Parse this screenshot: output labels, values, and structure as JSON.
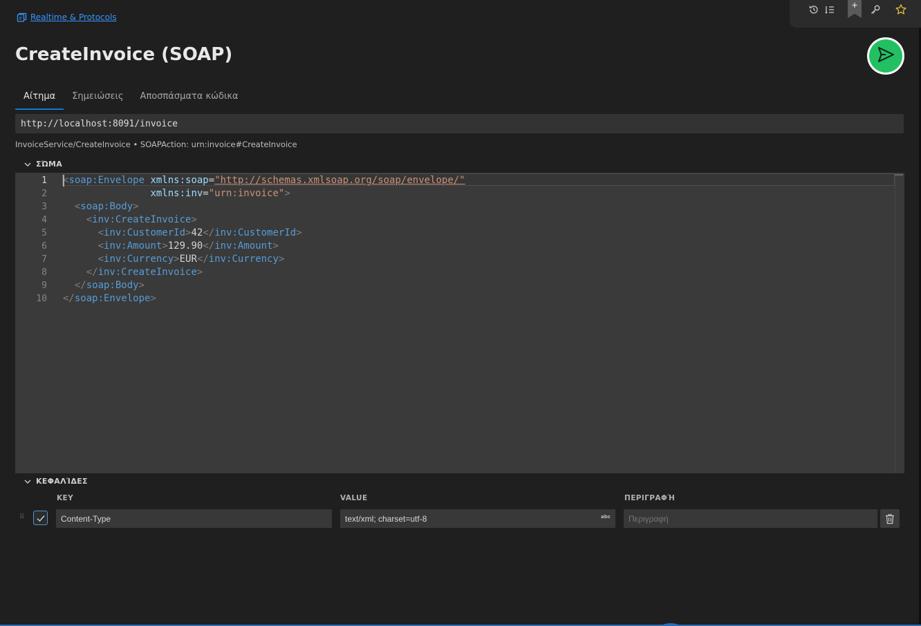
{
  "breadcrumb": {
    "label": "Realtime & Protocols"
  },
  "page": {
    "title": "CreateInvoice (SOAP)"
  },
  "tabs": [
    {
      "label": "Αίτημα",
      "active": true
    },
    {
      "label": "Σημειώσεις",
      "active": false
    },
    {
      "label": "Αποσπάσματα κώδικα",
      "active": false
    }
  ],
  "request": {
    "url": "http://localhost:8091/invoice",
    "operation_info": "InvoiceService/CreateInvoice • SOAPAction: urn:invoice#CreateInvoice"
  },
  "body_section": {
    "title": "ΣΏΜΑ",
    "line_numbers": [
      "1",
      "2",
      "3",
      "4",
      "5",
      "6",
      "7",
      "8",
      "9",
      "10"
    ],
    "current_line": 1,
    "code": {
      "l1_tag": "soap:Envelope",
      "l1_attr": "xmlns:soap",
      "l1_val": "\"http://schemas.xmlsoap.org/soap/envelope/\"",
      "l2_attr": "xmlns:inv",
      "l2_val": "\"urn:invoice\"",
      "l3_tag": "soap:Body",
      "l4_tag": "inv:CreateInvoice",
      "l5_tag": "inv:CustomerId",
      "l5_text": "42",
      "l6_tag": "inv:Amount",
      "l6_text": "129.90",
      "l7_tag": "inv:Currency",
      "l7_text": "EUR",
      "l8_tag": "inv:CreateInvoice",
      "l9_tag": "soap:Body",
      "l10_tag": "soap:Envelope"
    }
  },
  "headers_section": {
    "title": "ΚΕΦΑΛΊΔΕΣ",
    "columns": {
      "key": "KEY",
      "value": "VALUE",
      "description": "ΠΕΡΙΓΡΑΦΉ"
    },
    "rows": [
      {
        "enabled": true,
        "key": "Content-Type",
        "value": "text/xml; charset=utf-8",
        "value_type_badge": "abc",
        "description_placeholder": "Περιγραφή"
      }
    ]
  },
  "icons": {
    "breadcrumb": "collection-icon",
    "toolbar": [
      "history-icon",
      "list-icon",
      "bookmark-add-icon",
      "key-icon",
      "star-icon"
    ],
    "send": "send-icon",
    "delete": "trash-icon"
  },
  "colors": {
    "accent": "#0e7ad3",
    "send": "#23c063",
    "link": "#3794ff",
    "star": "#e2b93b"
  }
}
